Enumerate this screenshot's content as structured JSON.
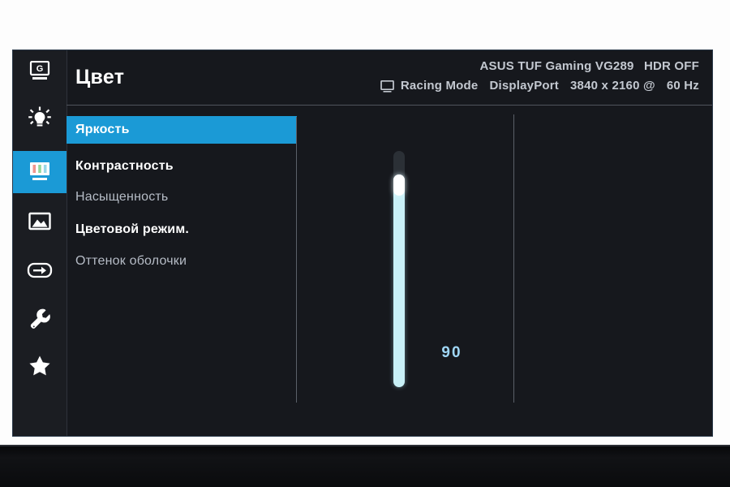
{
  "osd": {
    "title": "Цвет",
    "header": {
      "display_icon": "display-icon",
      "preset_mode": "Racing Mode",
      "input_source": "DisplayPort",
      "model": "ASUS TUF Gaming VG289",
      "hdr_status": "HDR OFF",
      "resolution": "3840 x 2160 @",
      "refresh_rate": "60 Hz"
    },
    "sidebar": [
      {
        "icon": "gaming-monitor-g-icon",
        "name": "gaming",
        "active": false
      },
      {
        "icon": "brightness-bulb-icon",
        "name": "blue-light",
        "active": false
      },
      {
        "icon": "color-bars-icon",
        "name": "color",
        "active": true
      },
      {
        "icon": "image-picture-icon",
        "name": "image",
        "active": false
      },
      {
        "icon": "input-select-icon",
        "name": "input",
        "active": false
      },
      {
        "icon": "wrench-icon",
        "name": "system",
        "active": false
      },
      {
        "icon": "star-icon",
        "name": "shortcut",
        "active": false
      }
    ],
    "menu_items": [
      {
        "label": "Яркость",
        "state": "selected"
      },
      {
        "label": "Контрастность",
        "state": "strong"
      },
      {
        "label": "Насыщенность",
        "state": "normal"
      },
      {
        "label": "Цветовой режим.",
        "state": "strong"
      },
      {
        "label": "Оттенок оболочки",
        "state": "normal"
      }
    ],
    "slider": {
      "value": "90",
      "value_number": 90,
      "min": 0,
      "max": 100,
      "orientation": "vertical"
    },
    "colors": {
      "accent": "#1b9ad6",
      "slider_fill": "#c8f0f7",
      "panel_background": "#16181d",
      "sidebar_background": "#1b1d22",
      "value_text": "#9fd6f5"
    }
  }
}
